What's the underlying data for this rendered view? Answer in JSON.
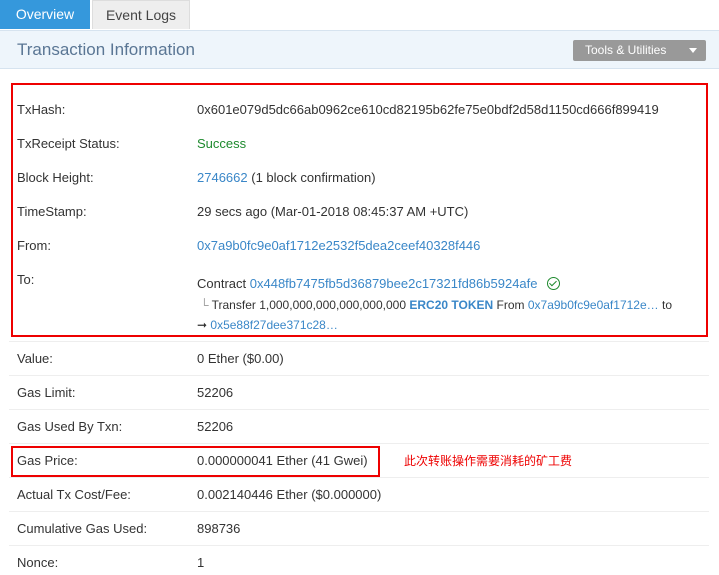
{
  "tabs": [
    {
      "label": "Overview"
    },
    {
      "label": "Event Logs"
    }
  ],
  "panel": {
    "title": "Transaction Information",
    "tools_label": "Tools & Utilities"
  },
  "rows": {
    "txhash": {
      "label": "TxHash:",
      "value": "0x601e079d5dc66ab0962ce610cd82195b62fe75e0bdf2d58d1150cd666f899419"
    },
    "status": {
      "label": "TxReceipt Status:",
      "value": "Success"
    },
    "block": {
      "label": "Block Height:",
      "value": "2746662",
      "suffix": "(1 block confirmation)"
    },
    "timestamp": {
      "label": "TimeStamp:",
      "value": "29 secs ago (Mar-01-2018 08:45:37 AM +UTC)"
    },
    "from": {
      "label": "From:",
      "value": "0x7a9b0fc9e0af1712e2532f5dea2ceef40328f446"
    },
    "to": {
      "label": "To:",
      "contract_prefix": "Contract",
      "contract": "0x448fb7475fb5d36879bee2c17321fd86b5924afe",
      "transfer_prefix": "Transfer",
      "transfer_amount": "1,000,000,000,000,000,000",
      "token": "ERC20 TOKEN",
      "from_word": "From",
      "transfer_from": "0x7a9b0fc9e0af1712e…",
      "to_word": "to",
      "transfer_to": "0x5e88f27dee371c28…"
    },
    "value": {
      "label": "Value:",
      "value": "0 Ether ($0.00)"
    },
    "gas_limit": {
      "label": "Gas Limit:",
      "value": "52206"
    },
    "gas_used": {
      "label": "Gas Used By Txn:",
      "value": "52206"
    },
    "gas_price": {
      "label": "Gas Price:",
      "value": "0.000000041 Ether (41 Gwei)"
    },
    "tx_cost": {
      "label": "Actual Tx Cost/Fee:",
      "value": "0.002140446 Ether ($0.000000)"
    },
    "cumulative": {
      "label": "Cumulative Gas Used:",
      "value": "898736"
    },
    "nonce": {
      "label": "Nonce:",
      "value": "1"
    }
  },
  "annotation": "此次转账操作需要消耗的矿工费",
  "colors": {
    "accent": "#3598dc",
    "link": "#3a87c8",
    "success": "#1e8a2e",
    "highlight": "#e00000"
  }
}
